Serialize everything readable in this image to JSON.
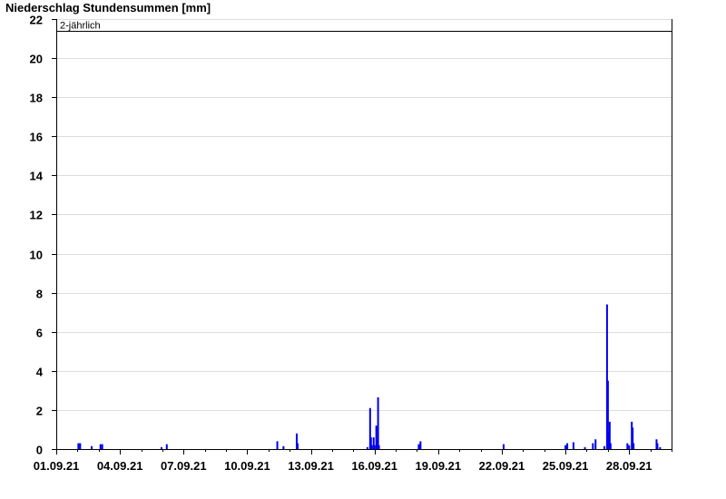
{
  "chart_data": {
    "type": "bar",
    "title": "Niederschlag Stundensummen [mm]",
    "ylim": [
      0,
      22
    ],
    "yticks": [
      0,
      2,
      4,
      6,
      8,
      10,
      12,
      14,
      16,
      18,
      20,
      22
    ],
    "xlim": [
      "2021-09-01T00:00",
      "2021-09-30T00:00"
    ],
    "xtick_labels": [
      "01.09.21",
      "04.09.21",
      "07.09.21",
      "10.09.21",
      "13.09.21",
      "16.09.21",
      "19.09.21",
      "22.09.21",
      "25.09.21",
      "28.09.21"
    ],
    "grid": true,
    "bar_color": "#0000ee",
    "reference_line": {
      "label": "2-jährlich",
      "value": 21.4
    },
    "bars": [
      [
        "2021-09-02T00:00",
        0.3
      ],
      [
        "2021-09-02T02:00",
        0.3
      ],
      [
        "2021-09-02T15:00",
        0.15
      ],
      [
        "2021-09-03T01:00",
        0.25
      ],
      [
        "2021-09-03T03:00",
        0.25
      ],
      [
        "2021-09-05T22:00",
        0.1
      ],
      [
        "2021-09-06T04:00",
        0.25
      ],
      [
        "2021-09-11T09:00",
        0.4
      ],
      [
        "2021-09-11T16:00",
        0.15
      ],
      [
        "2021-09-12T07:00",
        0.8
      ],
      [
        "2021-09-12T08:00",
        0.3
      ],
      [
        "2021-09-15T15:00",
        0.1
      ],
      [
        "2021-09-15T18:00",
        2.1
      ],
      [
        "2021-09-15T19:00",
        0.6
      ],
      [
        "2021-09-15T20:00",
        0.2
      ],
      [
        "2021-09-15T22:00",
        0.6
      ],
      [
        "2021-09-15T23:00",
        0.2
      ],
      [
        "2021-09-16T01:00",
        1.2
      ],
      [
        "2021-09-16T02:00",
        0.6
      ],
      [
        "2021-09-16T03:00",
        2.65
      ],
      [
        "2021-09-16T04:00",
        0.2
      ],
      [
        "2021-09-18T01:00",
        0.25
      ],
      [
        "2021-09-18T03:00",
        0.4
      ],
      [
        "2021-09-22T01:00",
        0.25
      ],
      [
        "2021-09-24T23:00",
        0.2
      ],
      [
        "2021-09-25T01:00",
        0.3
      ],
      [
        "2021-09-25T08:00",
        0.35
      ],
      [
        "2021-09-25T21:00",
        0.1
      ],
      [
        "2021-09-26T06:00",
        0.3
      ],
      [
        "2021-09-26T09:00",
        0.5
      ],
      [
        "2021-09-26T19:00",
        0.15
      ],
      [
        "2021-09-26T22:00",
        7.4
      ],
      [
        "2021-09-26T23:00",
        3.5
      ],
      [
        "2021-09-27T00:00",
        0.9
      ],
      [
        "2021-09-27T01:00",
        1.4
      ],
      [
        "2021-09-27T02:00",
        0.3
      ],
      [
        "2021-09-27T21:00",
        0.3
      ],
      [
        "2021-09-27T23:00",
        0.2
      ],
      [
        "2021-09-28T02:00",
        1.4
      ],
      [
        "2021-09-28T03:00",
        1.1
      ],
      [
        "2021-09-28T04:00",
        0.3
      ],
      [
        "2021-09-29T06:00",
        0.5
      ],
      [
        "2021-09-29T07:00",
        0.3
      ],
      [
        "2021-09-29T10:00",
        0.1
      ]
    ]
  }
}
